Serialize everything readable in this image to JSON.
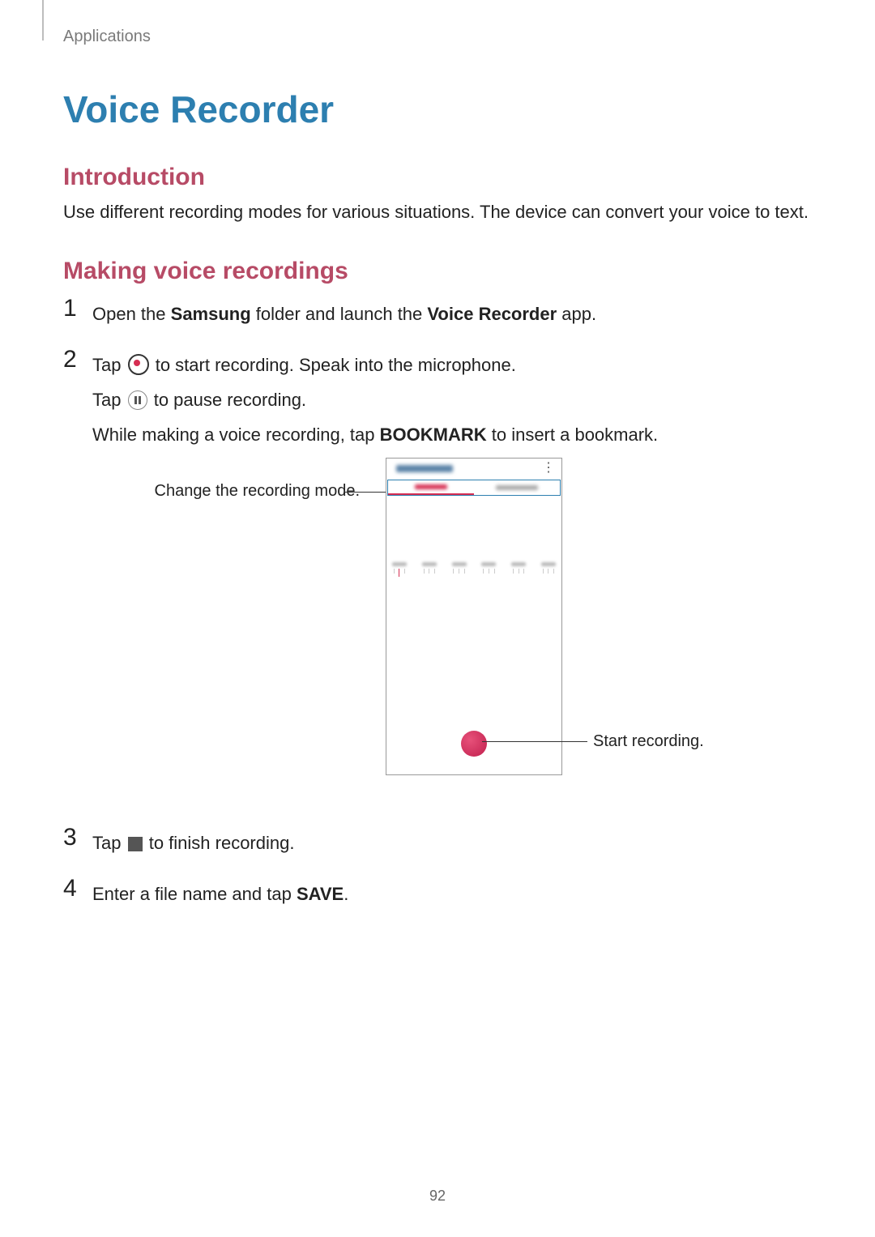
{
  "breadcrumb": "Applications",
  "title": "Voice Recorder",
  "sections": {
    "intro": {
      "heading": "Introduction",
      "body": "Use different recording modes for various situations. The device can convert your voice to text."
    },
    "making": {
      "heading": "Making voice recordings"
    }
  },
  "steps": {
    "s1": {
      "pre": "Open the ",
      "b1": "Samsung",
      "mid": " folder and launch the ",
      "b2": "Voice Recorder",
      "post": " app."
    },
    "s2": {
      "l1_pre": "Tap ",
      "l1_post": " to start recording. Speak into the microphone.",
      "l2_pre": "Tap ",
      "l2_post": " to pause recording.",
      "l3_pre": "While making a voice recording, tap ",
      "l3_bold": "BOOKMARK",
      "l3_post": " to insert a bookmark."
    },
    "s3": {
      "pre": "Tap ",
      "post": " to finish recording."
    },
    "s4": {
      "pre": "Enter a file name and tap ",
      "bold": "SAVE",
      "post": "."
    }
  },
  "figure": {
    "callout_left": "Change the recording mode.",
    "callout_right": "Start recording."
  },
  "pageNumber": "92"
}
